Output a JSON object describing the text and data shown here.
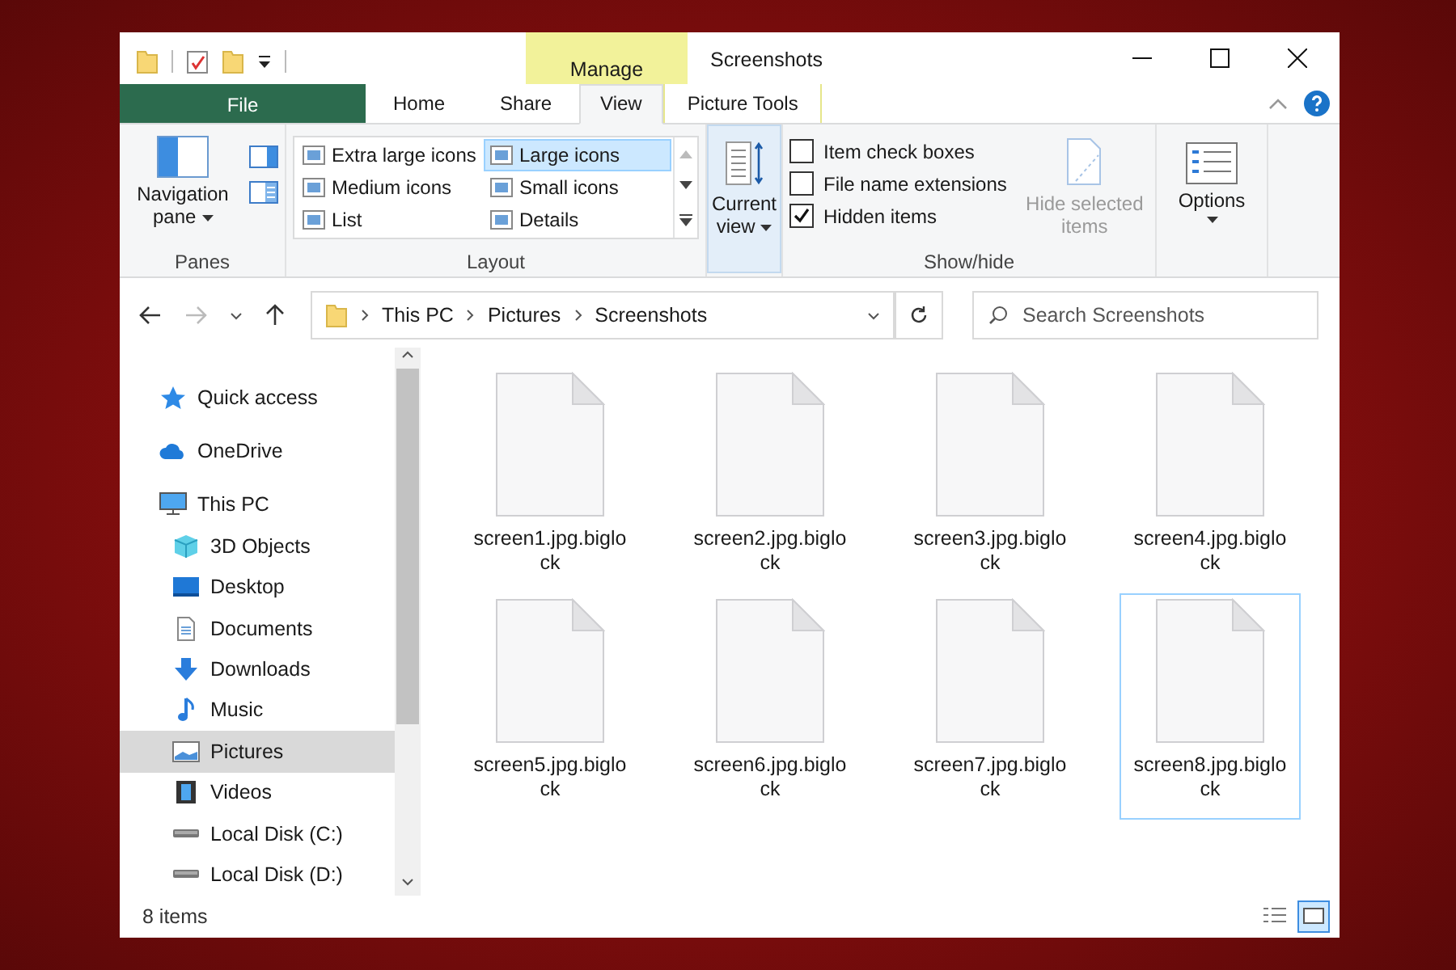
{
  "window": {
    "title": "Screenshots",
    "context_tab": "Manage"
  },
  "ribbon_tabs": [
    {
      "label": "File",
      "kind": "file",
      "selected": false
    },
    {
      "label": "Home",
      "kind": "plain",
      "selected": false
    },
    {
      "label": "Share",
      "kind": "plain",
      "selected": false
    },
    {
      "label": "View",
      "kind": "plain",
      "selected": true
    },
    {
      "label": "Picture Tools",
      "kind": "context",
      "selected": false
    }
  ],
  "ribbon": {
    "panes": {
      "label": "Panes",
      "navigation_pane": "Navigation pane"
    },
    "layout": {
      "label": "Layout",
      "options": [
        {
          "label": "Extra large icons",
          "selected": false
        },
        {
          "label": "Large icons",
          "selected": true
        },
        {
          "label": "Medium icons",
          "selected": false
        },
        {
          "label": "Small icons",
          "selected": false
        },
        {
          "label": "List",
          "selected": false
        },
        {
          "label": "Details",
          "selected": false
        }
      ]
    },
    "current_view": "Current view",
    "show_hide": {
      "label": "Show/hide",
      "checkboxes": [
        {
          "label": "Item check boxes",
          "checked": false
        },
        {
          "label": "File name extensions",
          "checked": false
        },
        {
          "label": "Hidden items",
          "checked": true
        }
      ],
      "hide_selected": {
        "label": "Hide selected items",
        "disabled": true
      }
    },
    "options": "Options"
  },
  "address": {
    "path": [
      "This PC",
      "Pictures",
      "Screenshots"
    ],
    "search_placeholder": "Search Screenshots"
  },
  "nav": [
    {
      "label": "Quick access",
      "selected": false
    },
    {
      "label": "OneDrive",
      "selected": false
    },
    {
      "label": "This PC",
      "selected": false,
      "children": [
        {
          "label": "3D Objects",
          "selected": false
        },
        {
          "label": "Desktop",
          "selected": false
        },
        {
          "label": "Documents",
          "selected": false
        },
        {
          "label": "Downloads",
          "selected": false
        },
        {
          "label": "Music",
          "selected": false
        },
        {
          "label": "Pictures",
          "selected": true
        },
        {
          "label": "Videos",
          "selected": false
        },
        {
          "label": "Local Disk (C:)",
          "selected": false
        },
        {
          "label": "Local Disk (D:)",
          "selected": false
        }
      ]
    }
  ],
  "files": [
    {
      "name": "screen1.jpg.biglock",
      "selected": false
    },
    {
      "name": "screen2.jpg.biglock",
      "selected": false
    },
    {
      "name": "screen3.jpg.biglock",
      "selected": false
    },
    {
      "name": "screen4.jpg.biglock",
      "selected": false
    },
    {
      "name": "screen5.jpg.biglock",
      "selected": false
    },
    {
      "name": "screen6.jpg.biglock",
      "selected": false
    },
    {
      "name": "screen7.jpg.biglock",
      "selected": false
    },
    {
      "name": "screen8.jpg.biglock",
      "selected": true
    }
  ],
  "status": "8 items"
}
